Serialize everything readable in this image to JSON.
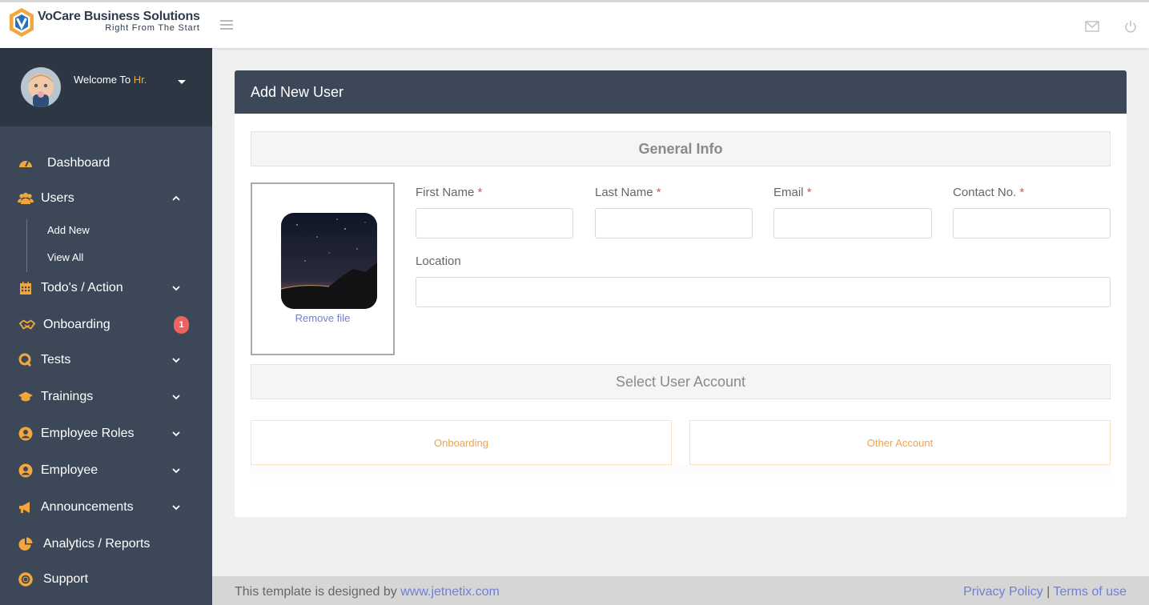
{
  "brand": {
    "name": "VoCare Business Solutions",
    "tagline": "Right From The Start"
  },
  "profile": {
    "welcome": "Welcome To",
    "user": "Hr."
  },
  "nav": {
    "dashboard": "Dashboard",
    "users": "Users",
    "users_sub": [
      "Add New",
      "View All"
    ],
    "todos": "Todo's / Action",
    "onboarding": "Onboarding",
    "onboarding_badge": "1",
    "tests": "Tests",
    "trainings": "Trainings",
    "employee_roles": "Employee Roles",
    "employee": "Employee",
    "announcements": "Announcements",
    "analytics": "Analytics / Reports",
    "support": "Support"
  },
  "form": {
    "title": "Add New User",
    "general_info": "General Info",
    "remove_file": "Remove file",
    "first_name": "First Name",
    "last_name": "Last Name",
    "email": "Email",
    "contact": "Contact No.",
    "required_mark": "*",
    "location": "Location",
    "select_account": "Select User Account",
    "onboarding_btn": "Onboarding",
    "other_btn": "Other Account"
  },
  "footer": {
    "prefix": "This template is designed by",
    "link": "www.jetnetix.com",
    "privacy": "Privacy Policy",
    "separator": "|",
    "terms": "Terms of use"
  },
  "colors": {
    "accent": "#f2a63b",
    "sidebar": "#3c4858",
    "link": "#6f7fd6",
    "badge": "#f0615f"
  }
}
